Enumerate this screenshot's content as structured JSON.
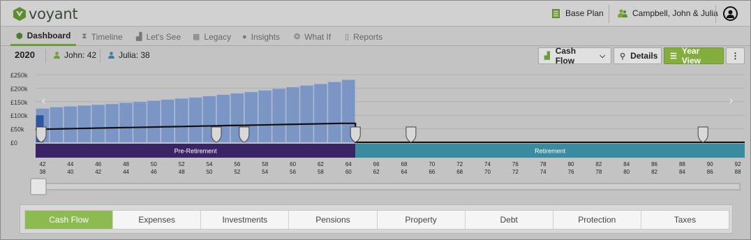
{
  "brand": {
    "name": "voyant"
  },
  "header": {
    "plan_label": "Base Plan",
    "client_label": "Campbell, John & Julia"
  },
  "nav": {
    "items": [
      {
        "label": "Dashboard",
        "icon": "cube-icon",
        "active": true
      },
      {
        "label": "Timeline",
        "icon": "hourglass-icon",
        "active": false
      },
      {
        "label": "Let's See",
        "icon": "bar-chart-icon",
        "active": false
      },
      {
        "label": "Legacy",
        "icon": "building-icon",
        "active": false
      },
      {
        "label": "Insights",
        "icon": "lightbulb-icon",
        "active": false
      },
      {
        "label": "What If",
        "icon": "brain-icon",
        "active": false
      },
      {
        "label": "Reports",
        "icon": "document-icon",
        "active": false
      }
    ]
  },
  "toolbar": {
    "year": "2020",
    "person1": "John: 42",
    "person2": "Julia: 38",
    "view_select": "Cash Flow",
    "details_label": "Details",
    "year_view_label": "Year View"
  },
  "chart_data": {
    "type": "bar",
    "y_ticks": [
      "£250k",
      "£200k",
      "£150k",
      "£100k",
      "£50k",
      "£0"
    ],
    "ylim": [
      0,
      250000
    ],
    "x": [
      42,
      43,
      44,
      45,
      46,
      47,
      48,
      49,
      50,
      51,
      52,
      53,
      54,
      55,
      56,
      57,
      58,
      59,
      60,
      61,
      62,
      63,
      64
    ],
    "series": [
      {
        "type": "bar",
        "values": [
          125000,
          130000,
          133000,
          136000,
          139000,
          142000,
          146000,
          150000,
          154000,
          158000,
          162000,
          166000,
          171000,
          176000,
          181000,
          186000,
          192000,
          198000,
          204000,
          210000,
          216000,
          223000,
          231000
        ]
      },
      {
        "type": "line",
        "values": [
          48000,
          49000,
          50000,
          51000,
          52000,
          53000,
          54000,
          55000,
          56000,
          57000,
          58000,
          59000,
          60000,
          61000,
          62000,
          63000,
          64000,
          65000,
          66000,
          67000,
          68000,
          69000,
          70000
        ]
      }
    ],
    "current_year_value": 100000,
    "periods": [
      {
        "label": "Pre-Retirement",
        "from": 42,
        "to": 65,
        "color": "#3b2466"
      },
      {
        "label": "Retirement",
        "from": 65,
        "to": 93,
        "color": "#3a8aa0"
      }
    ],
    "markers_at": [
      42,
      55,
      57,
      65,
      69,
      90
    ],
    "ages_john": [
      42,
      44,
      46,
      48,
      50,
      52,
      54,
      56,
      58,
      60,
      62,
      64,
      66,
      68,
      70,
      72,
      74,
      76,
      78,
      80,
      82,
      84,
      86,
      88,
      90,
      92
    ],
    "ages_julia": [
      38,
      40,
      42,
      44,
      46,
      48,
      50,
      52,
      54,
      56,
      58,
      60,
      62,
      64,
      66,
      68,
      70,
      72,
      74,
      76,
      78,
      80,
      82,
      84,
      86,
      88
    ],
    "x_range": [
      42,
      93
    ]
  },
  "bottom_tabs": [
    {
      "label": "Cash Flow",
      "active": true
    },
    {
      "label": "Expenses",
      "active": false
    },
    {
      "label": "Investments",
      "active": false
    },
    {
      "label": "Pensions",
      "active": false
    },
    {
      "label": "Property",
      "active": false
    },
    {
      "label": "Debt",
      "active": false
    },
    {
      "label": "Protection",
      "active": false
    },
    {
      "label": "Taxes",
      "active": false
    }
  ],
  "colors": {
    "accent": "#83ad3c",
    "bar": "#7b96c4",
    "bar_current": "#2d55a0",
    "pre_retirement": "#3b2466",
    "retirement": "#3a8aa0"
  }
}
